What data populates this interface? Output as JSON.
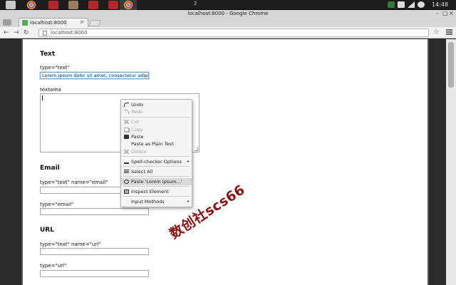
{
  "taskbar": {
    "workspace": "2",
    "clock": "14:48"
  },
  "window": {
    "title": "localhost:8000 - Google Chrome"
  },
  "tab": {
    "title": "localhost:8000",
    "close": "×"
  },
  "toolbar": {
    "back": "←",
    "forward": "→",
    "reload": "↻",
    "url": "localhost:8000",
    "star": "☆"
  },
  "page": {
    "sections": {
      "text": {
        "title": "Text",
        "input_label": "type=\"text\"",
        "input_value": "Lorem ipsum dolor sit amet, consectetur adipisicing",
        "textarea_label": "textarea",
        "textarea_value": ""
      },
      "email": {
        "title": "Email",
        "label1": "type=\"text\" name=\"email\"",
        "label2": "type=\"email\""
      },
      "url": {
        "title": "URL",
        "label1": "type=\"text\" name=\"url\"",
        "label2": "type=\"url\""
      }
    }
  },
  "context_menu": {
    "undo": "Undo",
    "redo": "Redo",
    "cut": "Cut",
    "copy": "Copy",
    "paste": "Paste",
    "paste_plain": "Paste as Plain Text",
    "delete": "Delete",
    "spell": "Spell-checker Options",
    "select_all": "Select All",
    "paste_lorem": "Paste 'Lorem ipsum...'",
    "inspect": "Inspect Element",
    "input_methods": "Input Methods",
    "arrow": "▸"
  },
  "watermark": {
    "text": "数创社scs66"
  },
  "colors": {
    "watermark": "#8e1010",
    "page_bg": "#ffffff",
    "highlight": "#d9d9d9"
  }
}
